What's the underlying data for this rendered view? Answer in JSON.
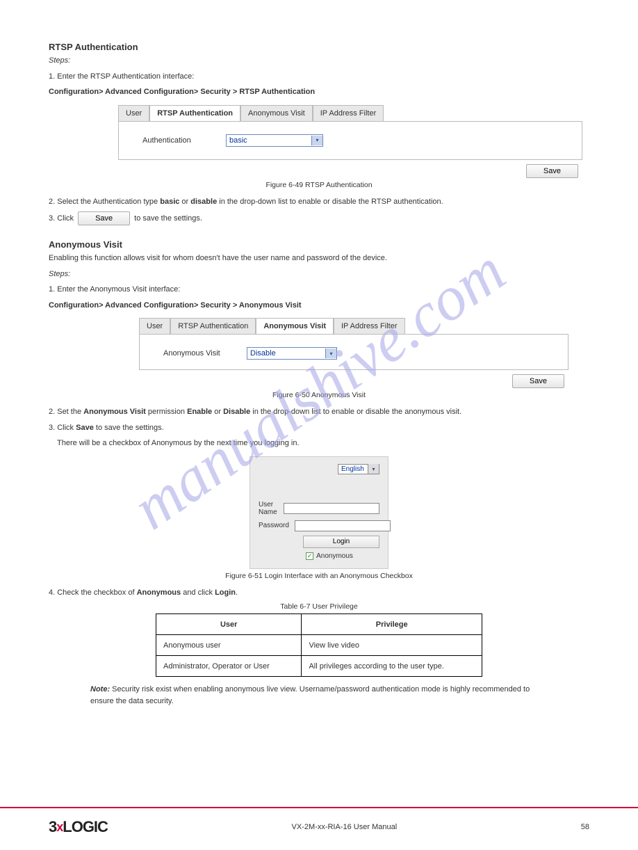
{
  "watermark": "manualshive.com",
  "section1": {
    "heading": "RTSP Authentication",
    "steps": {
      "intro": "Steps:",
      "s1": "1. Enter the RTSP Authentication interface:",
      "path": "Configuration> Advanced Configuration> Security > RTSP Authentication"
    }
  },
  "fig1": {
    "tabs": [
      "User",
      "RTSP Authentication",
      "Anonymous Visit",
      "IP Address Filter"
    ],
    "activeIndex": 1,
    "field_label": "Authentication",
    "field_value": "basic",
    "save": "Save",
    "caption": "Figure 6-49 RTSP Authentication"
  },
  "post1": {
    "s2a": "2. Select the Authentication type ",
    "s2b": "basic",
    "s2c": " or ",
    "s2d": "disable",
    "s2e": " in the drop-down list to enable or disable the RTSP authentication.",
    "s3a": "3. Click ",
    "s3b": " to save the settings.",
    "save_img_label": "Save"
  },
  "section2": {
    "heading": "Anonymous Visit",
    "para": "Enabling this function allows visit for whom doesn't have the user name and password of the device.",
    "steps_intro": "Steps:",
    "s1": "1. Enter the Anonymous Visit interface:",
    "path": "Configuration> Advanced Configuration> Security > Anonymous Visit"
  },
  "fig2": {
    "tabs": [
      "User",
      "RTSP Authentication",
      "Anonymous Visit",
      "IP Address Filter"
    ],
    "activeIndex": 2,
    "field_label": "Anonymous Visit",
    "field_value": "Disable",
    "save": "Save",
    "caption": "Figure 6-50 Anonymous Visit"
  },
  "post2": {
    "s2a": "2. Set the ",
    "s2b": "Anonymous Visit",
    "s2c": " permission ",
    "s2d": "Enable",
    "s2e": " or ",
    "s2f": "Disable",
    "s2g": " in the drop-down list to enable or disable the anonymous visit.",
    "s3a": "3. Click ",
    "s3b": "Save",
    "s3c": " to save the settings.",
    "s3d": "There will be a checkbox of Anonymous by the next time you logging in."
  },
  "login": {
    "language": "English",
    "user_label": "User Name",
    "pass_label": "Password",
    "login_btn": "Login",
    "anon_label": "Anonymous",
    "caption": "Figure 6-51 Login Interface with an Anonymous Checkbox"
  },
  "post3": {
    "s4a": "4. Check the checkbox of ",
    "s4b": "Anonymous",
    "s4c": " and click ",
    "s4d": "Login",
    "s4e": "."
  },
  "table": {
    "caption": "Table 6-7 User Privilege",
    "head": [
      "User",
      "Privilege"
    ],
    "rows": [
      [
        "Anonymous user",
        "View live video"
      ],
      [
        "Administrator, Operator or User",
        "All privileges according to the user type."
      ]
    ]
  },
  "note": {
    "title": "Note:",
    "text": " Security risk exist when enabling anonymous live view. Username/password authentication mode is highly recommended to ensure the data security."
  },
  "footer": {
    "manual": "VX-2M-xx-RIA-16 User Manual",
    "page": "58"
  },
  "logo": {
    "a": "3",
    "x": "x",
    "b": "LOGIC"
  }
}
